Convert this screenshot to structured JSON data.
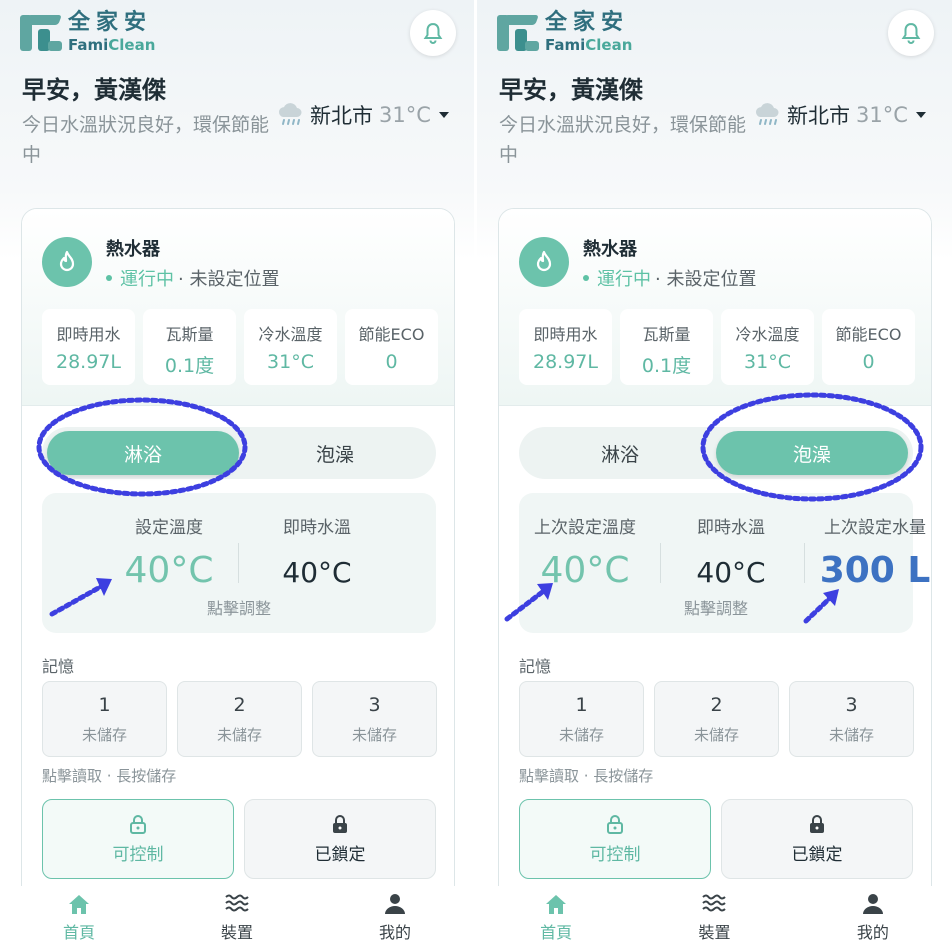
{
  "panels": [
    {
      "brand": {
        "cn": "全家安",
        "en_a": "Fami",
        "en_b": "Clean"
      },
      "greeting": "早安，黃漢傑",
      "status": "今日水溫狀況良好，環保節能中",
      "weather": {
        "icon": "rain-cloud-icon",
        "city": "新北市",
        "temp": "31°C"
      },
      "device": {
        "name": "熱水器",
        "running": "運行中",
        "location": "· 未設定位置",
        "stats": [
          {
            "label": "即時用水",
            "value": "28.97L"
          },
          {
            "label": "瓦斯量",
            "value": "0.1度"
          },
          {
            "label": "冷水溫度",
            "value": "31°C"
          },
          {
            "label": "節能ECO",
            "value": "0"
          }
        ]
      },
      "modes": {
        "shower": "淋浴",
        "bath": "泡澡",
        "active": "shower"
      },
      "temps": {
        "set_label": "設定溫度",
        "set_value": "40°C",
        "live_label": "即時水溫",
        "live_value": "40°C",
        "hint": "點擊調整"
      },
      "memory": {
        "label": "記憶",
        "slots": [
          {
            "num": "1",
            "state": "未儲存"
          },
          {
            "num": "2",
            "state": "未儲存"
          },
          {
            "num": "3",
            "state": "未儲存"
          }
        ],
        "hint": "點擊讀取 · 長按儲存"
      },
      "controls": {
        "controllable": "可控制",
        "locked": "已鎖定"
      },
      "nav": {
        "home": "首頁",
        "devices": "裝置",
        "me": "我的",
        "active": "home"
      }
    },
    {
      "brand": {
        "cn": "全家安",
        "en_a": "Fami",
        "en_b": "Clean"
      },
      "greeting": "早安，黃漢傑",
      "status": "今日水溫狀況良好，環保節能中",
      "weather": {
        "icon": "rain-cloud-icon",
        "city": "新北市",
        "temp": "31°C"
      },
      "device": {
        "name": "熱水器",
        "running": "運行中",
        "location": "· 未設定位置",
        "stats": [
          {
            "label": "即時用水",
            "value": "28.97L"
          },
          {
            "label": "瓦斯量",
            "value": "0.1度"
          },
          {
            "label": "冷水溫度",
            "value": "31°C"
          },
          {
            "label": "節能ECO",
            "value": "0"
          }
        ]
      },
      "modes": {
        "shower": "淋浴",
        "bath": "泡澡",
        "active": "bath"
      },
      "temps": {
        "set_label": "上次設定溫度",
        "set_value": "40°C",
        "live_label": "即時水溫",
        "live_value": "40°C",
        "volume_label": "上次設定水量",
        "volume_value": "300 L",
        "hint": "點擊調整"
      },
      "memory": {
        "label": "記憶",
        "slots": [
          {
            "num": "1",
            "state": "未儲存"
          },
          {
            "num": "2",
            "state": "未儲存"
          },
          {
            "num": "3",
            "state": "未儲存"
          }
        ],
        "hint": "點擊讀取 · 長按儲存"
      },
      "controls": {
        "controllable": "可控制",
        "locked": "已鎖定"
      },
      "nav": {
        "home": "首頁",
        "devices": "裝置",
        "me": "我的",
        "active": "home"
      }
    }
  ],
  "colors": {
    "teal": "#6cc3ac",
    "teal_text": "#5fb8a3",
    "brand_dark": "#2f6f7e",
    "blue_value": "#3d72c2",
    "annotation": "#3d3fe0"
  }
}
